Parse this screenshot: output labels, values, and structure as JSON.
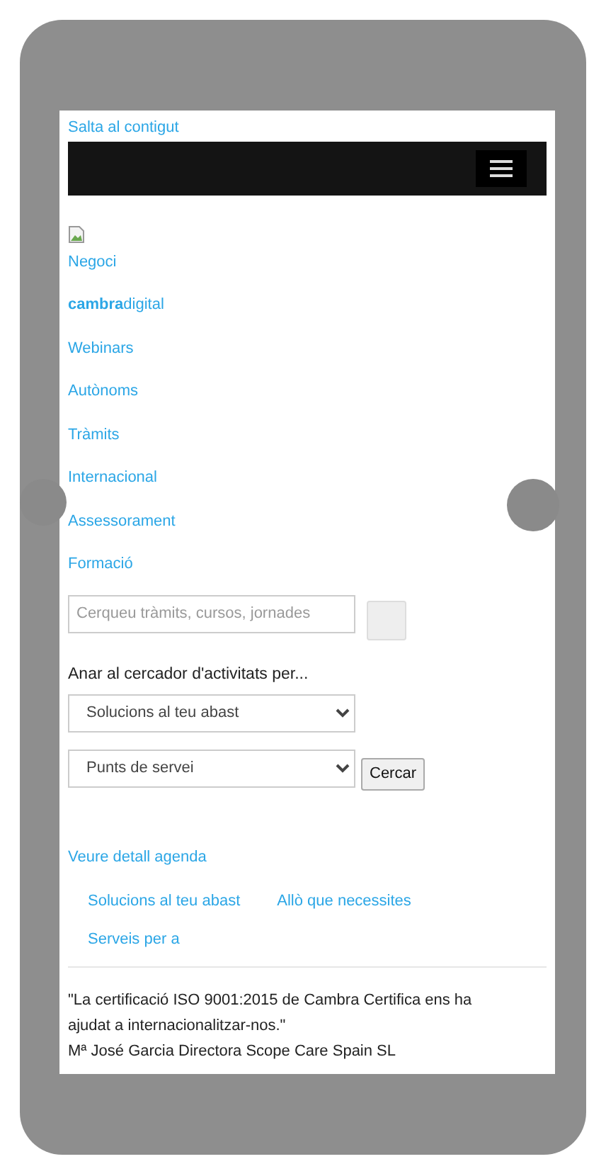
{
  "skip_link": "Salta al contigut",
  "nav_links": [
    {
      "label": "Negoci"
    },
    {
      "label": "**cambra**digital"
    },
    {
      "label": "Webinars"
    },
    {
      "label": "Autònoms"
    },
    {
      "label": "Tràmits"
    },
    {
      "label": "Internacional"
    },
    {
      "label": "Assessorament"
    },
    {
      "label": "Formació"
    }
  ],
  "search": {
    "placeholder": "Cerqueu tràmits, cursos, jornades"
  },
  "activity_finder": {
    "label": "Anar al cercador d'activitats per...",
    "selects": [
      "Solucions al teu abast",
      "Punts de servei"
    ],
    "button": "Cercar"
  },
  "agenda_link": "Veure detall agenda",
  "tab_links": [
    {
      "label": "Solucions al teu abast"
    },
    {
      "label": "Allò que necessites"
    },
    {
      "label": "Serveis per a"
    }
  ],
  "testimonial": {
    "quote": "\"La certificació ISO 9001:2015 de Cambra Certifica ens ha ajudat a internacionalitzar-nos.\"",
    "author": "Mª José Garcia Directora Scope Care Spain SL"
  }
}
